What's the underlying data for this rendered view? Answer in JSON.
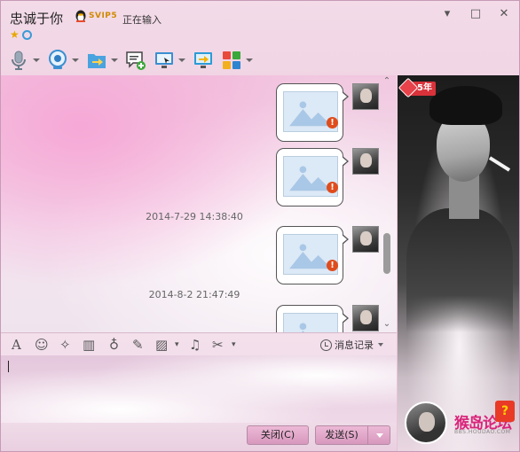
{
  "window": {
    "contact_name": "忠诚于你",
    "vip_label": "SVIP5",
    "typing_status": "正在输入",
    "controls": [
      "minimize-icon",
      "restore-icon",
      "close-icon"
    ]
  },
  "toolbar": {
    "items": [
      {
        "icon": "microphone-icon",
        "has_menu": true
      },
      {
        "icon": "webcam-icon",
        "has_menu": true
      },
      {
        "icon": "send-file-icon",
        "has_menu": true
      },
      {
        "icon": "new-discussion-icon",
        "has_menu": false
      },
      {
        "icon": "remote-assist-icon",
        "has_menu": true
      },
      {
        "icon": "share-screen-icon",
        "has_menu": false
      },
      {
        "icon": "apps-grid-icon",
        "has_menu": true
      }
    ]
  },
  "chat": {
    "messages": [
      {
        "type": "image",
        "status": "failed"
      },
      {
        "type": "image",
        "status": "failed"
      },
      {
        "type": "timestamp",
        "text": "2014-7-29 14:38:40"
      },
      {
        "type": "image",
        "status": "failed"
      },
      {
        "type": "timestamp",
        "text": "2014-8-2 21:47:49"
      },
      {
        "type": "image",
        "status": "failed"
      }
    ],
    "error_glyph": "!"
  },
  "input_toolbar": {
    "tools": [
      "font-icon",
      "emoji-icon",
      "magic-icon",
      "screen-shake-icon",
      "voice-message-icon",
      "edit-icon",
      "image-icon",
      "music-icon",
      "screenshot-icon"
    ],
    "history_label": "消息记录"
  },
  "buttons": {
    "close_label": "关闭(C)",
    "send_label": "发送(S)"
  },
  "side_panel": {
    "year_badge": "5年",
    "watermark": "猴岛论坛",
    "watermark_url": "BBS.HOUDAO.COM"
  }
}
